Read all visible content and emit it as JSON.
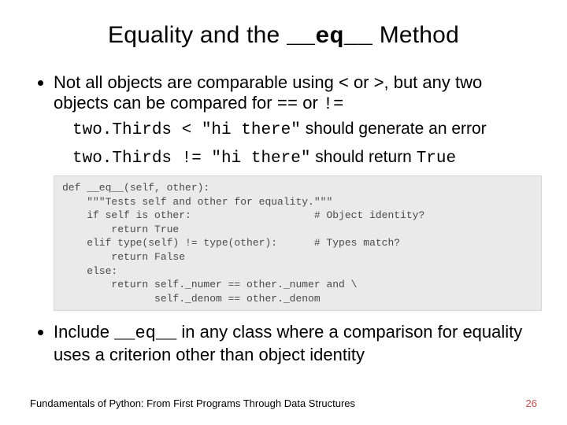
{
  "title": {
    "prefix": "Equality and the ",
    "method": "__eq__",
    "suffix": " Method"
  },
  "bullet1": {
    "t1": "Not all objects are comparable using ",
    "op1": "<",
    "t2": " or ",
    "op2": ">",
    "t3": ", but any two objects can be compared for ",
    "op3": "==",
    "t4": " or ",
    "op4": "!="
  },
  "sub1": {
    "code": "two.Thirds < \"hi there\"",
    "rest": " should generate an error"
  },
  "sub2": {
    "code": "two.Thirds != \"hi there\"",
    "rest1": " should return ",
    "val": "True"
  },
  "code_block": "def __eq__(self, other):\n    \"\"\"Tests self and other for equality.\"\"\"\n    if self is other:                    # Object identity?\n        return True\n    elif type(self) != type(other):      # Types match?\n        return False\n    else:\n        return self._numer == other._numer and \\\n               self._denom == other._denom",
  "bullet2": {
    "t1": "Include ",
    "method": "__eq__",
    "t2": " in any class where a comparison for equality uses a criterion other than object identity"
  },
  "footer": {
    "text": "Fundamentals of Python: From First Programs Through Data Structures",
    "page": "26"
  }
}
